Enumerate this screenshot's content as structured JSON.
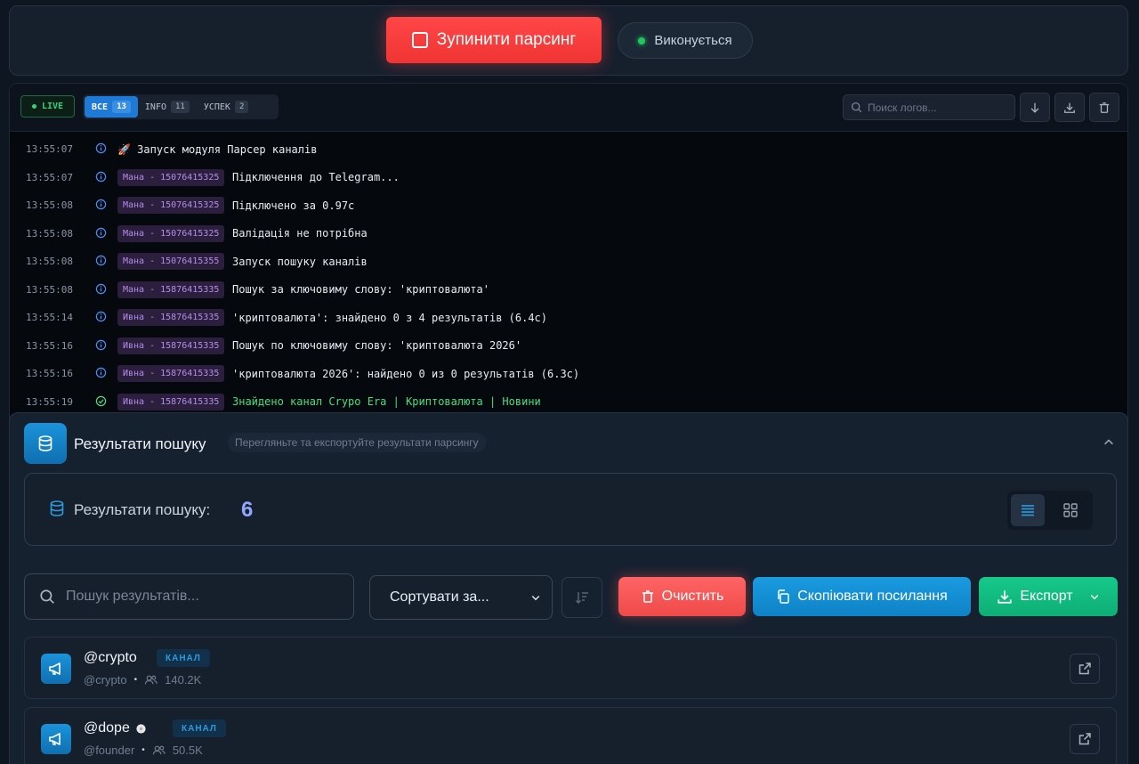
{
  "top": {
    "stop_label": "Зупинити парсинг",
    "status_label": "Виконується"
  },
  "log": {
    "live_label": "LIVE",
    "filters": [
      {
        "label": "ВСЕ",
        "count": "13"
      },
      {
        "label": "INFO",
        "count": "11"
      },
      {
        "label": "УСПЕК",
        "count": "2"
      }
    ],
    "search_placeholder": "Поиск логов...",
    "rows": [
      {
        "time": "13:55:07",
        "tag": "",
        "msg": "🚀 Запуск модуля Парсер каналів",
        "level": "info"
      },
      {
        "time": "13:55:07",
        "tag": "Мана - 15076415325",
        "msg": "Підключення до Telegram...",
        "level": "info"
      },
      {
        "time": "13:55:08",
        "tag": "Мана - 15076415325",
        "msg": "Підключено за 0.97с",
        "level": "info"
      },
      {
        "time": "13:55:08",
        "tag": "Мана - 15076415325",
        "msg": "Валідація не потрібна",
        "level": "info"
      },
      {
        "time": "13:55:08",
        "tag": "Мана - 15076415355",
        "msg": "Запуск пошуку каналів",
        "level": "info"
      },
      {
        "time": "13:55:08",
        "tag": "Мана - 15876415335",
        "msg": "Пошук за ключовиму слову: 'криптовалюта'",
        "level": "info"
      },
      {
        "time": "13:55:14",
        "tag": "Ивна - 15876415335",
        "msg": "'криптовалюта': знайдено 0 з 4 результатів (6.4с)",
        "level": "info"
      },
      {
        "time": "13:55:16",
        "tag": "Ивна - 15876415335",
        "msg": "Пошук по ключовиму слову: 'криптовалюта 2026'",
        "level": "info"
      },
      {
        "time": "13:55:16",
        "tag": "Ивна - 15876415335",
        "msg": "'криптовалюта 2026': найдено 0 из 0 результатів (6.3с)",
        "level": "info"
      },
      {
        "time": "13:55:19",
        "tag": "Ивна - 15876415335",
        "msg": "Знайдено канал Cryро Era | Криптовалюта | Новини",
        "level": "success"
      }
    ]
  },
  "results": {
    "title": "Результати пошуку",
    "subtitle": "Перегляньте та експортуйте результати парсингу",
    "count_label": "Результати пошуку:",
    "count_value": "6",
    "search_placeholder": "Пошук результатів...",
    "sort_label": "Сортувати за...",
    "clear_label": "Очистить",
    "copy_label": "Скопіювати посилання",
    "export_label": "Експорт",
    "channels": [
      {
        "name": "@crypto",
        "badge": "КАНАЛ",
        "handle": "@crypto",
        "subs": "140.2K"
      },
      {
        "name": "@dope",
        "badge": "КАНАЛ",
        "handle": "@founder",
        "subs": "50.5K"
      }
    ]
  },
  "colors": {
    "accent": "#1e7ad6",
    "danger": "#ff4646",
    "success": "#16c98a",
    "tag_bg": "#2b1f3d"
  }
}
